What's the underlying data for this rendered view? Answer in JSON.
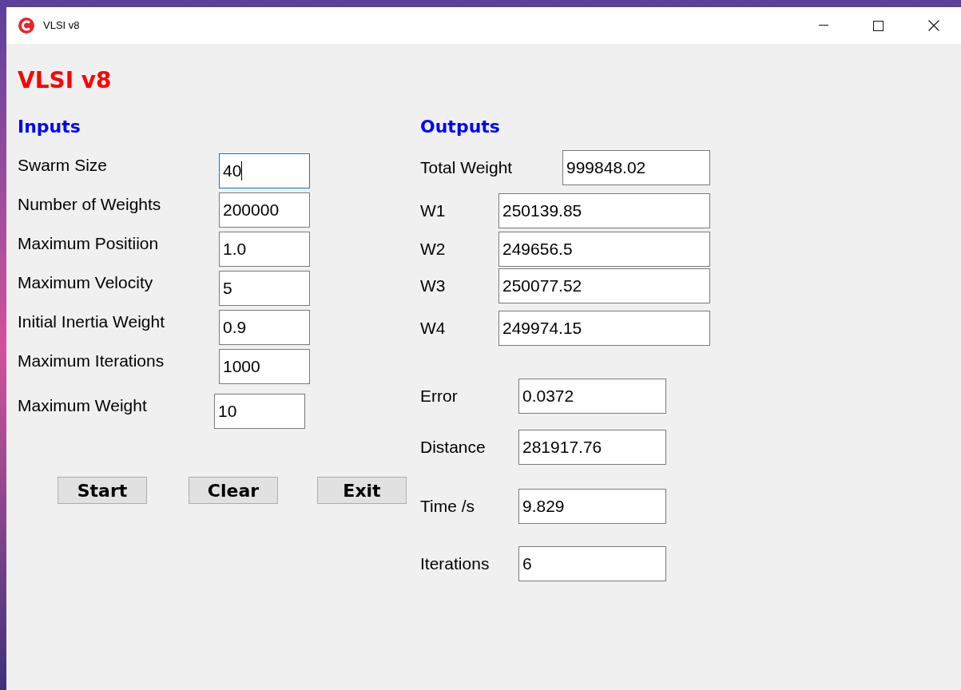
{
  "window": {
    "title": "VLSI v8"
  },
  "app_title": "VLSI v8",
  "inputs": {
    "heading": "Inputs",
    "fields": [
      {
        "label": "Swarm Size",
        "value": "40",
        "focused": true
      },
      {
        "label": "Number of Weights",
        "value": "200000",
        "focused": false
      },
      {
        "label": "Maximum Positiion",
        "value": "1.0",
        "focused": false
      },
      {
        "label": "Maximum Velocity",
        "value": "5",
        "focused": false
      },
      {
        "label": "Initial Inertia Weight",
        "value": "0.9",
        "focused": false
      },
      {
        "label": "Maximum Iterations",
        "value": "1000",
        "focused": false
      },
      {
        "label": "Maximum Weight",
        "value": "10",
        "focused": false
      }
    ]
  },
  "buttons": [
    "Start",
    "Clear",
    "Exit"
  ],
  "outputs": {
    "heading": "Outputs",
    "fields": [
      {
        "label": "Total Weight",
        "value": "999848.02"
      },
      {
        "label": "W1",
        "value": "250139.85"
      },
      {
        "label": "W2",
        "value": "249656.5"
      },
      {
        "label": "W3",
        "value": "250077.52"
      },
      {
        "label": "W4",
        "value": "249974.15"
      },
      {
        "label": "Error",
        "value": "0.0372"
      },
      {
        "label": "Distance",
        "value": "281917.76"
      },
      {
        "label": "Time /s",
        "value": "9.829"
      },
      {
        "label": "Iterations",
        "value": "6"
      }
    ]
  }
}
